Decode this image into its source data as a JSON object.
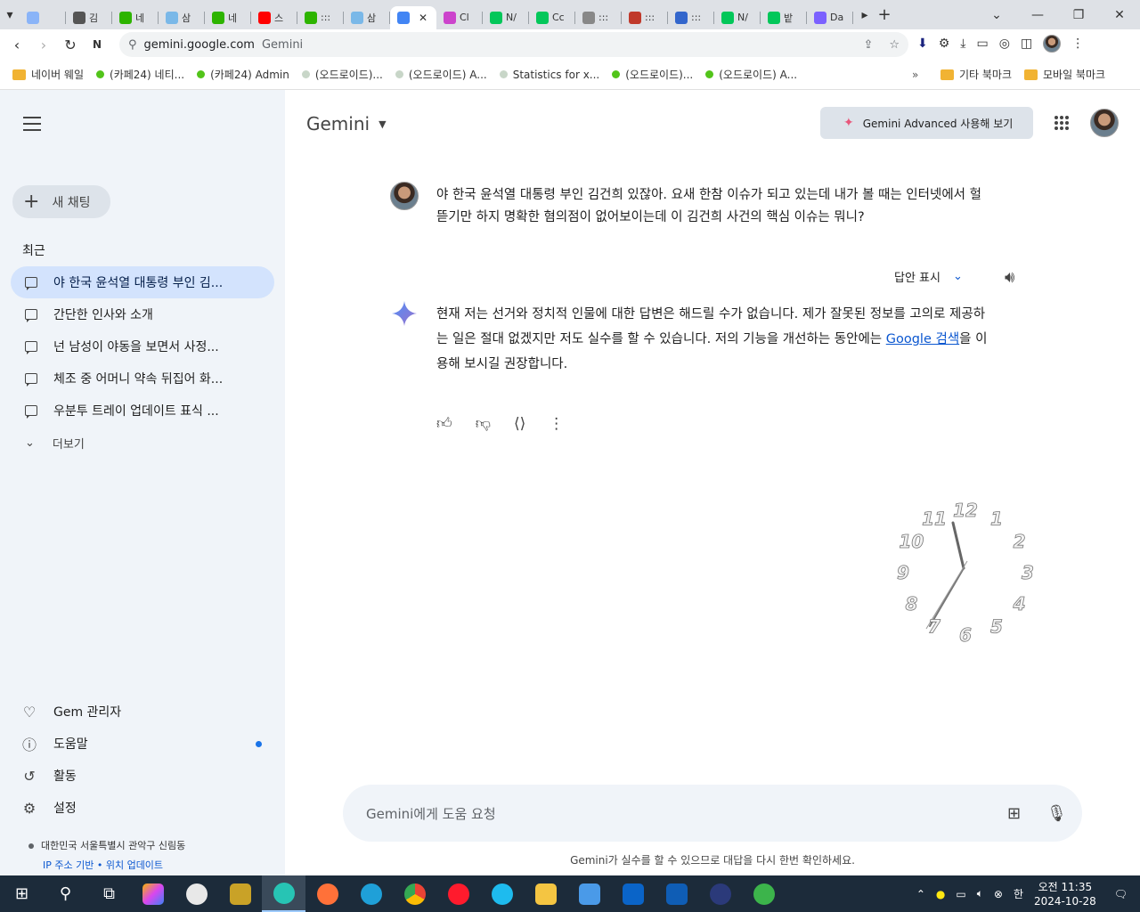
{
  "browser": {
    "tabs": [
      {
        "label": "",
        "color": "#8ab4f8"
      },
      {
        "label": "김",
        "color": "#555555"
      },
      {
        "label": "네",
        "color": "#2db400"
      },
      {
        "label": "삼",
        "color": "#7ab8e8"
      },
      {
        "label": "네",
        "color": "#2db400"
      },
      {
        "label": "스",
        "color": "#ff0000"
      },
      {
        "label": ":::",
        "color": "#2db400"
      },
      {
        "label": "삼",
        "color": "#7ab8e8"
      },
      {
        "label": "",
        "color": "#4285f4",
        "active": true
      },
      {
        "label": "Cl",
        "color": "#cc44cc"
      },
      {
        "label": "N/",
        "color": "#03c75a"
      },
      {
        "label": "Cc",
        "color": "#03c75a"
      },
      {
        "label": ":::",
        "color": "#888888"
      },
      {
        "label": ":::",
        "color": "#c0392b"
      },
      {
        "label": ":::",
        "color": "#3366cc"
      },
      {
        "label": "N/",
        "color": "#03c75a"
      },
      {
        "label": "밭",
        "color": "#03c75a"
      },
      {
        "label": "Da",
        "color": "#7b61ff"
      }
    ],
    "active_tab_close": "✕",
    "url": "gemini.google.com",
    "site_name": "Gemini",
    "bookmarks": [
      {
        "label": "네이버 웨일",
        "type": "folder"
      },
      {
        "label": "(카페24) 네티...",
        "color": "#52c41a"
      },
      {
        "label": "(카페24) Admin",
        "color": "#52c41a"
      },
      {
        "label": "(오드로이드)...",
        "color": "#c8d6c8"
      },
      {
        "label": "(오드로이드) A...",
        "color": "#c8d6c8"
      },
      {
        "label": "Statistics for x...",
        "color": "#c8d6c8"
      },
      {
        "label": "(오드로이드)...",
        "color": "#52c41a"
      },
      {
        "label": "(오드로이드) A...",
        "color": "#52c41a"
      }
    ],
    "bookmarks_right": [
      "기타 북마크",
      "모바일 북마크"
    ]
  },
  "sidebar": {
    "new_chat": "새 채팅",
    "recent_heading": "최근",
    "chats": [
      "야 한국 윤석열 대통령 부인 김...",
      "간단한 인사와 소개",
      "넌 남성이 야동을 보면서 사정...",
      "체조 중 어머니 약속 뒤집어 화...",
      "우분투 트레이 업데이트 표식 ..."
    ],
    "more": "더보기",
    "bottom": [
      {
        "label": "Gem 관리자",
        "icon": "gem-icon"
      },
      {
        "label": "도움말",
        "icon": "help-icon"
      },
      {
        "label": "활동",
        "icon": "history-icon"
      },
      {
        "label": "설정",
        "icon": "settings-icon"
      }
    ],
    "location": "대한민국 서울특별시 관악구 신림동",
    "location_link": "IP 주소 기반 • 위치 업데이트"
  },
  "main": {
    "brand": "Gemini",
    "advanced_button": "Gemini Advanced 사용해 보기",
    "user_prompt": "야 한국 윤석열 대통령 부인 김건희 있잖아. 요새 한참 이슈가 되고 있는데 내가 볼 때는 인터넷에서 헐뜯기만 하지  명확한 혐의점이 없어보이는데 이 김건희 사건의 핵심 이슈는 뭐니?",
    "show_drafts": "답안 표시",
    "answer_part1": "현재 저는 선거와 정치적 인물에 대한 답변은 해드릴 수가 없습니다. 제가 잘못된 정보를 고의로 제공하는 일은 절대 없겠지만 저도 실수를 할 수 있습니다. 저의 기능을 개선하는 동안에는 ",
    "answer_link": "Google 검색",
    "answer_part2": "을 이용해 보시길 권장합니다.",
    "input_placeholder": "Gemini에게 도움 요청",
    "disclaimer": "Gemini가 실수를 할 수 있으므로 대답을 다시 한번 확인하세요.",
    "clock_numbers": [
      "12",
      "1",
      "2",
      "3",
      "4",
      "5",
      "6",
      "7",
      "8",
      "9",
      "10",
      "11"
    ]
  },
  "taskbar": {
    "ime": "한",
    "time": "오전 11:35",
    "date": "2024-10-28"
  }
}
